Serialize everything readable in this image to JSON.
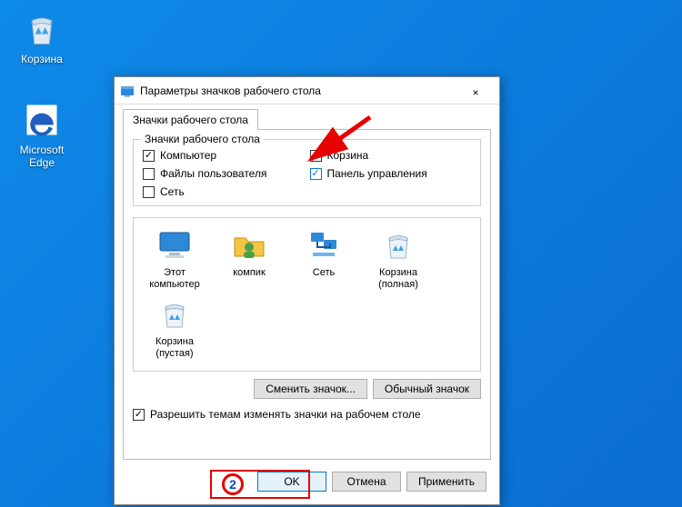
{
  "desktop": {
    "recycle_label": "Корзина",
    "edge_label": "Microsoft Edge"
  },
  "dialog": {
    "title": "Параметры значков рабочего стола",
    "tab_label": "Значки рабочего стола",
    "group_legend": "Значки рабочего стола",
    "checkboxes": {
      "computer": "Компьютер",
      "user_files": "Файлы пользователя",
      "network": "Сеть",
      "recycle": "Корзина",
      "control_panel": "Панель управления"
    },
    "icons": {
      "this_pc": "Этот компьютер",
      "kompik": "компик",
      "network": "Сеть",
      "recycle_full": "Корзина (полная)",
      "recycle_empty": "Корзина (пустая)"
    },
    "change_icon_btn": "Сменить значок...",
    "default_icon_btn": "Обычный значок",
    "themes_checkbox": "Разрешить темам изменять значки на рабочем столе",
    "ok": "OK",
    "cancel": "Отмена",
    "apply": "Применить"
  },
  "annotations": {
    "badge": "2"
  }
}
